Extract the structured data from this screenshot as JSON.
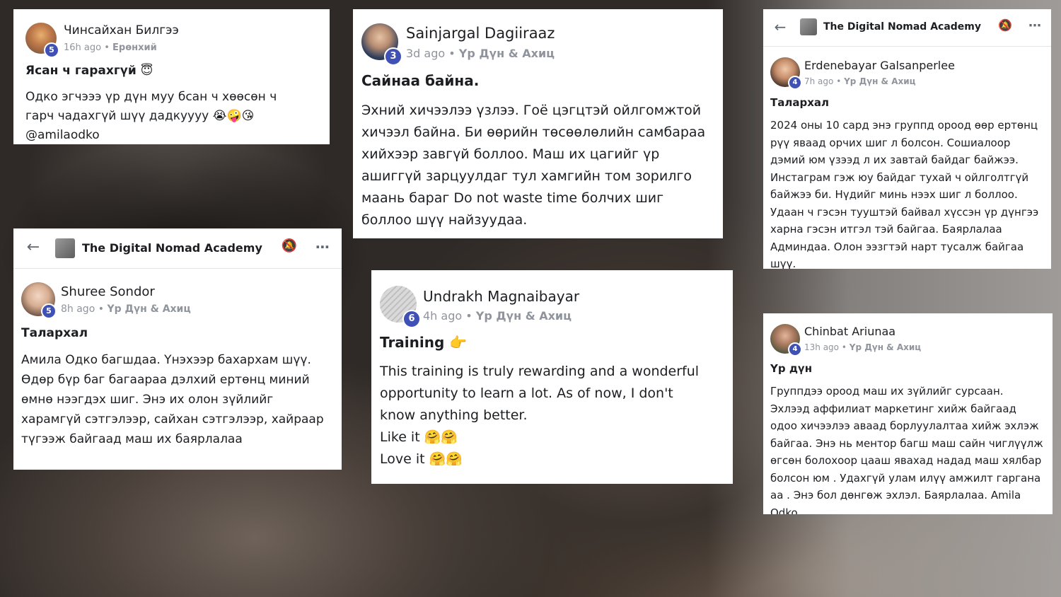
{
  "cards": {
    "c1": {
      "name": "Чинсайхан Билгээ",
      "level": "5",
      "time": "16h ago",
      "category": "Ерөнхий",
      "title": "Ясан ч гарахгүй 😇",
      "body": "Одко эгчэээ үр дүн муу бсан ч хөөсөн ч гарч чадахгүй шүү дадкуууу 😭🤪😘@amilaodko"
    },
    "c2": {
      "name": "Sainjargal Dagiiraaz",
      "level": "3",
      "time": "3d ago",
      "category": "Үр Дүн & Ахиц",
      "title": "Сайнаа байна.",
      "body": "Эхний хичээлээ үзлээ. Гоё цэгцтэй ойлгомжтой хичээл байна. Би өөрийн төсөөлөлийн самбараа хийхээр завгүй боллоо. Маш их цагийг үр ашиггүй зарцуулдаг тул хамгийн том зорилго маань бараг Do not waste time болчих шиг боллоо шүү найзуудаа."
    },
    "c3": {
      "group": "The Digital Nomad Academy",
      "name": "Erdenebayar Galsanperlee",
      "level": "4",
      "time": "7h ago",
      "category": "Үр Дүн & Ахиц",
      "title": "Талархал",
      "body": "2024 оны 10 сард энэ группд ороод өөр ертөнц рүү яваад орчих шиг л болсон. Сошиалоор дэмий юм үзээд л их завтай байдаг байжээ. Инстаграм гэж юу байдаг тухай ч ойлголтгүй байжээ би. Нүдийг минь нээх шиг л боллоо. Удаан ч гэсэн тууштэй байвал хүссэн үр дүнгээ харна гэсэн итгэл тэй байгаа. Баярлалаа Админдаа. Олон ээзгтэй нарт тусалж байгаа шүү."
    },
    "c4": {
      "group": "The Digital Nomad Academy",
      "name": "Shuree Sondor",
      "level": "5",
      "time": "8h ago",
      "category": "Үр Дүн & Ахиц",
      "title": "Талархал",
      "body": "Амила Одко багшдаа. Үнэхээр бахархам шүү. Өдөр бүр баг багаараа дэлхий ертөнц миний өмнө нээгдэх шиг. Энэ их олон зүйлийг харамгүй сэтгэлээр, сайхан сэтгэлээр, хайраар түгээж байгаад маш их баярлалаа"
    },
    "c5": {
      "name": "Undrakh Magnaibayar",
      "level": "6",
      "time": "4h ago",
      "category": "Үр Дүн & Ахиц",
      "title": "Training 👉",
      "body": "This training is truly rewarding and a wonderful opportunity to learn a lot. As of now, I don't know anything better.",
      "line2": "Like it 🤗🤗",
      "line3": "Love it 🤗🤗"
    },
    "c6": {
      "name": "Chinbat Ariunaa",
      "level": "4",
      "time": "13h ago",
      "category": "Үр Дүн & Ахиц",
      "title": "Үр дүн",
      "body": "Группдээ ороод маш их зүйлийг сурсаан. Эхлээд аффилиат маркетинг хийж байгаад одоо хичээлээ аваад борлуулалтаа хийж эхлэж байгаа. Энэ нь ментор багш маш сайн чиглүүлж өгсөн болохоор цааш явахад надад маш хялбар болсон юм . Удахгүй улам илүү амжилт гаргана аа . Энэ бол дөнгөж эхлэл. Баярлалаа. Amila Odko"
    }
  },
  "meta_separator": "•",
  "icons": {
    "back": "arrow-left-icon",
    "bell": "bell-off-icon",
    "more": "more-horizontal-icon",
    "group": "group-thumbnail-icon"
  },
  "colors": {
    "badge": "#3f51b5",
    "meta": "#90949c",
    "text": "#1c1e21"
  }
}
